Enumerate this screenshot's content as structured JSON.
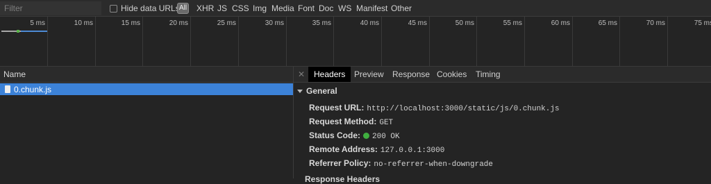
{
  "filter_bar": {
    "filter_placeholder": "Filter",
    "hide_data_urls_label": "Hide data URLs",
    "all_label": "All",
    "types": [
      "XHR",
      "JS",
      "CSS",
      "Img",
      "Media",
      "Font",
      "Doc",
      "WS",
      "Manifest",
      "Other"
    ]
  },
  "timeline": {
    "ticks": [
      "5 ms",
      "10 ms",
      "15 ms",
      "20 ms",
      "25 ms",
      "30 ms",
      "35 ms",
      "40 ms",
      "45 ms",
      "50 ms",
      "55 ms",
      "60 ms",
      "65 ms",
      "70 ms",
      "75 ms"
    ]
  },
  "requests": {
    "column_header": "Name",
    "items": [
      {
        "name": "0.chunk.js"
      }
    ]
  },
  "detail": {
    "close_icon": "close-icon",
    "tabs": [
      "Headers",
      "Preview",
      "Response",
      "Cookies",
      "Timing"
    ],
    "active_tab": "Headers",
    "general": {
      "title": "General",
      "rows": [
        {
          "key": "Request URL:",
          "value": "http://localhost:3000/static/js/0.chunk.js"
        },
        {
          "key": "Request Method:",
          "value": "GET"
        },
        {
          "key": "Status Code:",
          "value": "200 OK"
        },
        {
          "key": "Remote Address:",
          "value": "127.0.0.1:3000"
        },
        {
          "key": "Referrer Policy:",
          "value": "no-referrer-when-downgrade"
        }
      ]
    },
    "next_section_title": "Response Headers"
  },
  "colors": {
    "selection": "#3c82d8",
    "status_ok": "#3fae3f",
    "waterfall": "#4d8bd6"
  }
}
